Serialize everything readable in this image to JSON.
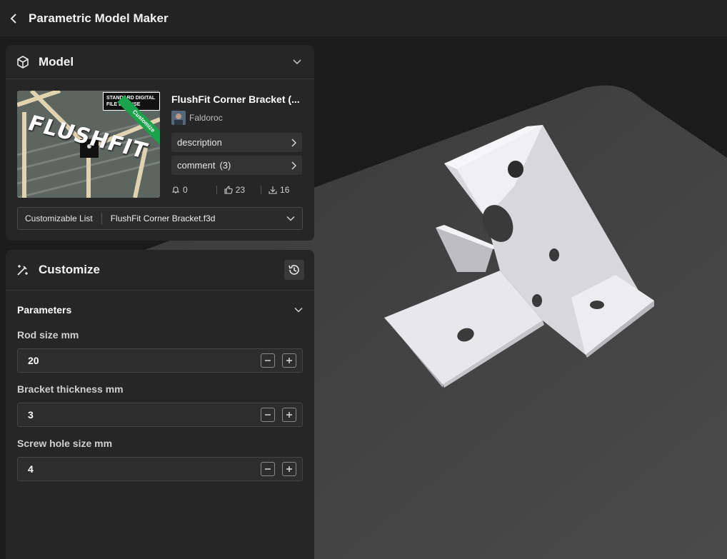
{
  "header": {
    "title": "Parametric Model Maker"
  },
  "model_panel": {
    "title": "Model",
    "thumbnail": {
      "license_text": "STANDARD DIGITAL FILE LICENSE",
      "logo_text": "FLUSHFIT",
      "ribbon_text": "Customize"
    },
    "model_name": "FlushFit Corner Bracket (...",
    "author": "Faldoroc",
    "description_label": "description",
    "comment_label": "comment",
    "comment_count": "(3)",
    "stats": {
      "boosts": "0",
      "likes": "23",
      "downloads": "16"
    },
    "customizable_list_label": "Customizable List",
    "selected_file": "FlushFit Corner Bracket.f3d"
  },
  "customize_panel": {
    "title": "Customize",
    "parameters_title": "Parameters",
    "params": [
      {
        "label": "Rod size mm",
        "value": "20"
      },
      {
        "label": "Bracket thickness mm",
        "value": "3"
      },
      {
        "label": "Screw hole size mm",
        "value": "4"
      }
    ]
  },
  "colors": {
    "background": "#1c1c1c",
    "panel": "#262626",
    "accent_green": "#1aa34a",
    "model": "#ececf0"
  },
  "icons": [
    "back-icon",
    "cube-icon",
    "chevron-down-icon",
    "chevron-right-icon",
    "bell-icon",
    "thumbs-up-icon",
    "download-icon",
    "magic-wand-icon",
    "history-icon",
    "minus-icon",
    "plus-icon"
  ]
}
